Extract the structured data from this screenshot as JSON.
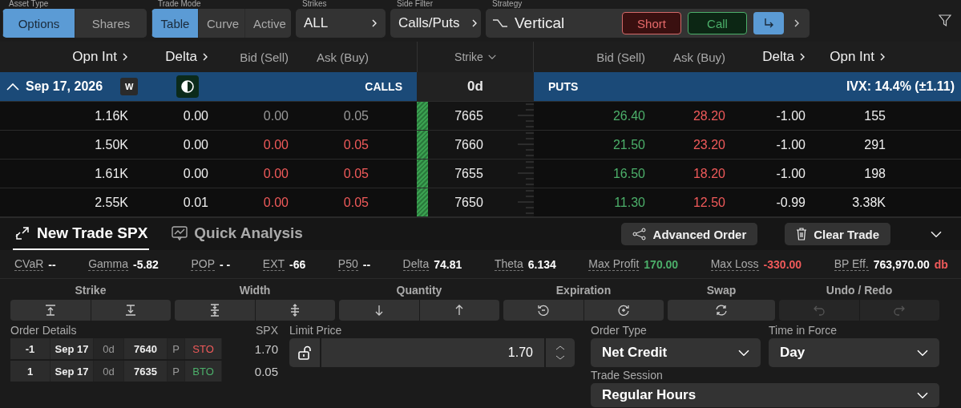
{
  "asset_type": {
    "label": "Asset Type",
    "options": [
      {
        "label": "Options",
        "selected": true
      },
      {
        "label": "Shares",
        "selected": false
      }
    ]
  },
  "trade_mode": {
    "label": "Trade Mode",
    "options": [
      {
        "label": "Table",
        "selected": true
      },
      {
        "label": "Curve",
        "selected": false
      },
      {
        "label": "Active",
        "selected": false
      }
    ]
  },
  "strikes": {
    "label": "Strikes",
    "value": "ALL"
  },
  "side_filter": {
    "label": "Side Filter",
    "value": "Calls/Puts"
  },
  "strategy": {
    "label": "Strategy",
    "value": "Vertical",
    "direction": "Short",
    "side": "Call"
  },
  "chain": {
    "call_columns": [
      {
        "label": "Opn Int",
        "has_menu": true
      },
      {
        "label": "Delta",
        "has_menu": true
      },
      {
        "label": "Bid (Sell)",
        "has_menu": false
      },
      {
        "label": "Ask (Buy)",
        "has_menu": false
      }
    ],
    "strike_column": "Strike",
    "put_columns": [
      {
        "label": "Bid (Sell)",
        "has_menu": false
      },
      {
        "label": "Ask (Buy)",
        "has_menu": false
      },
      {
        "label": "Delta",
        "has_menu": true
      },
      {
        "label": "Opn Int",
        "has_menu": true
      }
    ],
    "expiration": {
      "date": "Sep 17, 2026",
      "expanded": true,
      "badge": "W",
      "calls_label": "CALLS",
      "days": "0d",
      "puts_label": "PUTS",
      "ivx": "IVX: 14.4% (±1.11)"
    },
    "rows": [
      {
        "calls": {
          "open_interest": "1.16K",
          "delta": "0.00",
          "bid": "0.00",
          "ask": "0.05",
          "stale": true
        },
        "strike": "7665",
        "puts": {
          "bid": "26.40",
          "ask": "28.20",
          "delta": "-1.00",
          "open_interest": "155"
        }
      },
      {
        "calls": {
          "open_interest": "1.50K",
          "delta": "0.00",
          "bid": "0.00",
          "ask": "0.05",
          "stale": false
        },
        "strike": "7660",
        "puts": {
          "bid": "21.50",
          "ask": "23.20",
          "delta": "-1.00",
          "open_interest": "291"
        }
      },
      {
        "calls": {
          "open_interest": "1.61K",
          "delta": "0.00",
          "bid": "0.00",
          "ask": "0.05",
          "stale": false
        },
        "strike": "7655",
        "puts": {
          "bid": "16.50",
          "ask": "18.20",
          "delta": "-1.00",
          "open_interest": "198"
        }
      },
      {
        "calls": {
          "open_interest": "2.55K",
          "delta": "0.01",
          "bid": "0.00",
          "ask": "0.05",
          "stale": false
        },
        "strike": "7650",
        "puts": {
          "bid": "11.30",
          "ask": "12.50",
          "delta": "-0.99",
          "open_interest": "3.38K"
        }
      }
    ]
  },
  "trade": {
    "tabs": [
      {
        "label": "New Trade SPX",
        "selected": true
      },
      {
        "label": "Quick Analysis",
        "selected": false
      }
    ],
    "actions": [
      {
        "label": "Advanced Order",
        "kind": "advanced"
      },
      {
        "label": "Clear Trade",
        "kind": "clear"
      }
    ],
    "metrics": [
      {
        "label": "CVaR",
        "value": "--",
        "kind": "plain"
      },
      {
        "label": "Gamma",
        "value": "-5.82",
        "kind": "plain"
      },
      {
        "label": "POP",
        "value": "- -",
        "kind": "plain"
      },
      {
        "label": "EXT",
        "value": "-66",
        "kind": "plain"
      },
      {
        "label": "P50",
        "value": "--",
        "kind": "plain"
      },
      {
        "label": "Delta",
        "value": "74.81",
        "kind": "plain"
      },
      {
        "label": "Theta",
        "value": "6.134",
        "kind": "plain"
      },
      {
        "label": "Max Profit",
        "value": "170.00",
        "kind": "gain"
      },
      {
        "label": "Max Loss",
        "value": "-330.00",
        "kind": "loss"
      },
      {
        "label": "BP Eff.",
        "value": "763,970.00",
        "suffix": "db",
        "kind": "plain"
      }
    ],
    "adjusters": [
      {
        "label": "Strike",
        "buttons": [
          {
            "kind": "raise",
            "disabled": false
          },
          {
            "kind": "lower",
            "disabled": false
          }
        ]
      },
      {
        "label": "Width",
        "buttons": [
          {
            "kind": "narrow",
            "disabled": false
          },
          {
            "kind": "widen",
            "disabled": false
          }
        ]
      },
      {
        "label": "Quantity",
        "buttons": [
          {
            "kind": "down",
            "disabled": false
          },
          {
            "kind": "up",
            "disabled": false
          }
        ]
      },
      {
        "label": "Expiration",
        "buttons": [
          {
            "kind": "earlier",
            "disabled": false
          },
          {
            "kind": "later",
            "disabled": false
          }
        ]
      },
      {
        "label": "Swap",
        "buttons": [
          {
            "kind": "swap",
            "disabled": false
          }
        ]
      },
      {
        "label": "Undo / Redo",
        "buttons": [
          {
            "kind": "undo",
            "disabled": true
          },
          {
            "kind": "redo",
            "disabled": true
          }
        ]
      }
    ],
    "order_details": {
      "label": "Order Details",
      "price_label": "SPX",
      "legs": [
        {
          "quantity": "-1",
          "date": "Sep 17",
          "days": "0d",
          "strike": "7640",
          "type": "P",
          "action": "STO",
          "kind": "sell",
          "price": "1.70"
        },
        {
          "quantity": "1",
          "date": "Sep 17",
          "days": "0d",
          "strike": "7635",
          "type": "P",
          "action": "BTO",
          "kind": "buy",
          "price": "0.05"
        }
      ]
    },
    "limit_price": {
      "label": "Limit Price",
      "value": "1.70",
      "locked": false
    },
    "order_type": {
      "label": "Order Type",
      "value": "Net Credit"
    },
    "time_in_force": {
      "label": "Time in Force",
      "value": "Day"
    },
    "trade_session": {
      "label": "Trade Session",
      "value": "Regular Hours"
    }
  }
}
